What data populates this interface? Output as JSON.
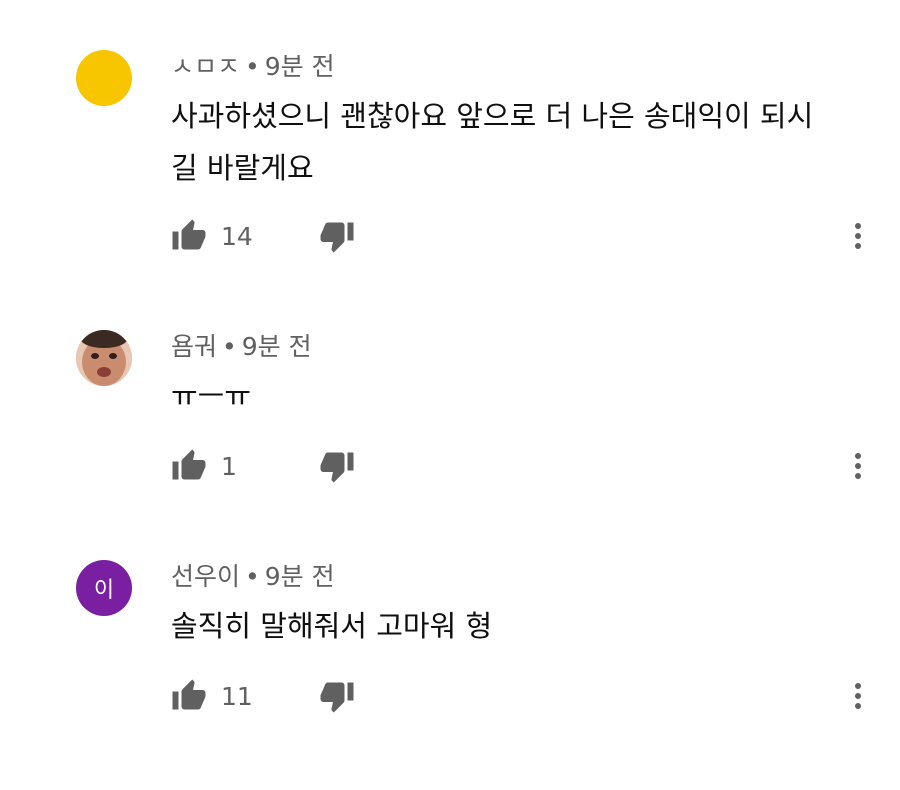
{
  "comments": [
    {
      "author": "ㅅㅁㅈ",
      "time": "9분 전",
      "text": "사과하셨으니 괜찮아요 앞으로 더 나은 송대익이 되시길 바랄게요",
      "likes": "14",
      "avatar": {
        "type": "color",
        "color": "#f7c600",
        "initial": ""
      }
    },
    {
      "author": "욤궈",
      "time": "9분 전",
      "text": "ㅠㅡㅠ",
      "likes": "1",
      "avatar": {
        "type": "photo",
        "color": "#c98c6e",
        "initial": ""
      }
    },
    {
      "author": "선우이",
      "time": "9분 전",
      "text": "솔직히 말해줘서 고마워 형",
      "likes": "11",
      "avatar": {
        "type": "initial",
        "color": "#7b1fa2",
        "initial": "이"
      }
    }
  ],
  "ui": {
    "separator": "•",
    "icon_color": "#606060",
    "like_icon": "thumbs-up-icon",
    "dislike_icon": "thumbs-down-icon",
    "more_icon": "more-vert-icon"
  }
}
